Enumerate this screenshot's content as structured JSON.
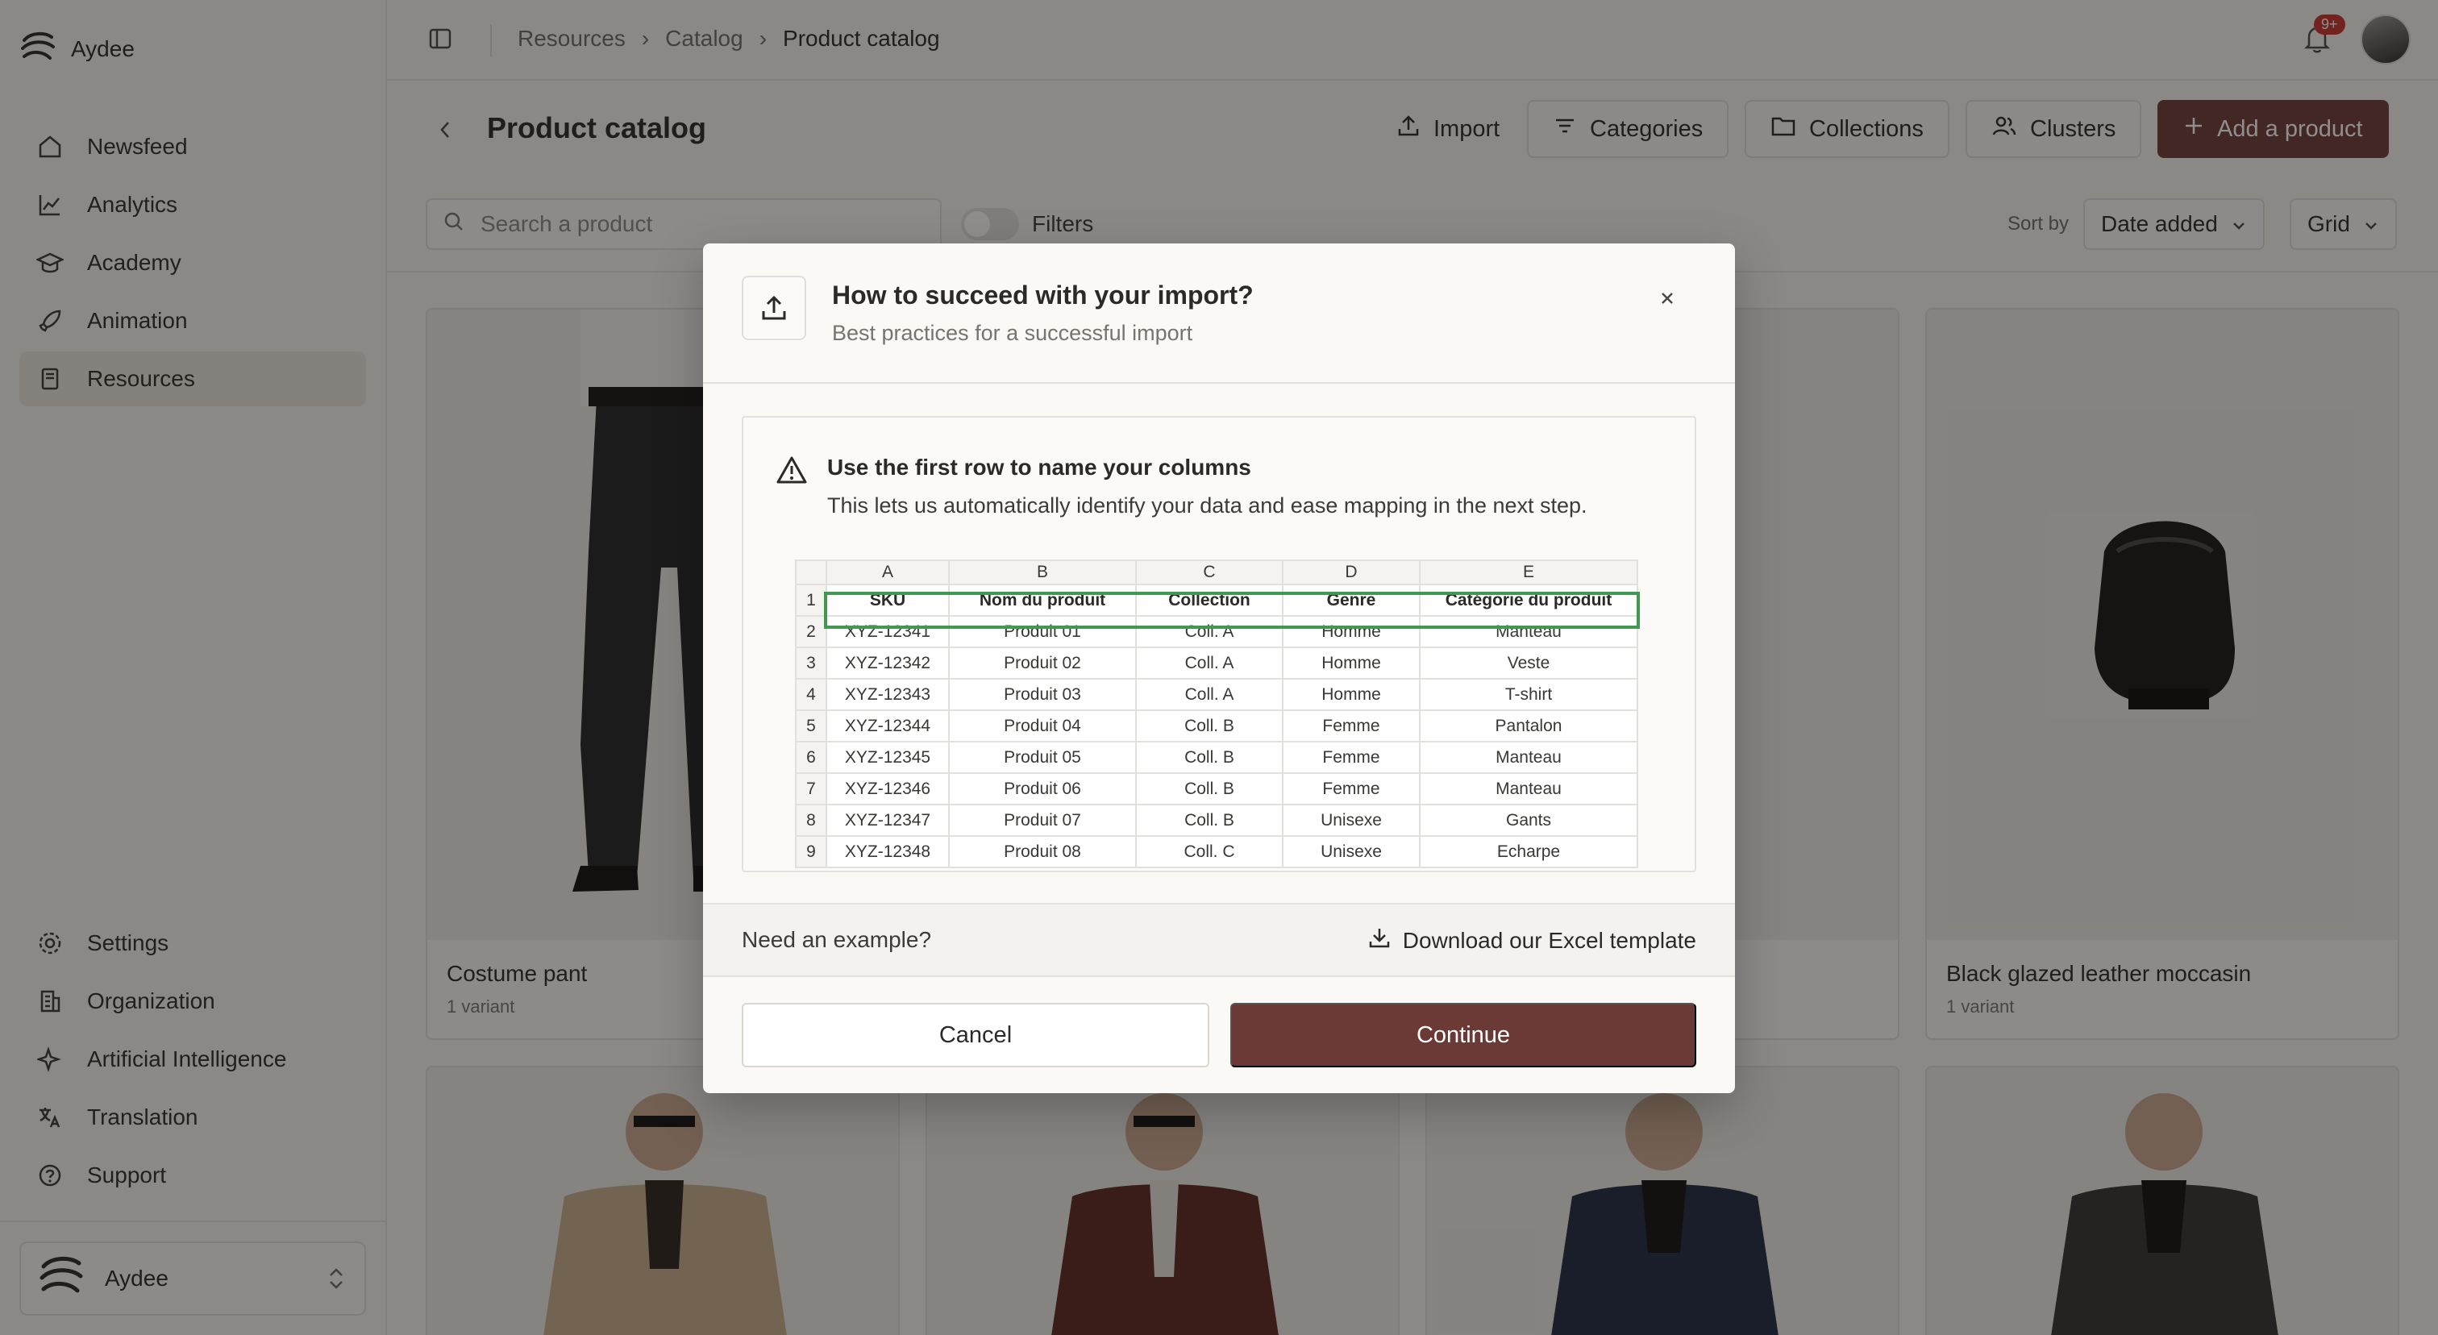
{
  "app": {
    "name": "Aydee",
    "notifications_badge": "9+"
  },
  "sidebar": {
    "items": [
      {
        "label": "Newsfeed",
        "icon": "home-icon"
      },
      {
        "label": "Analytics",
        "icon": "chart-line-icon"
      },
      {
        "label": "Academy",
        "icon": "graduation-cap-icon"
      },
      {
        "label": "Animation",
        "icon": "rocket-icon"
      },
      {
        "label": "Resources",
        "icon": "book-icon",
        "active": true
      }
    ],
    "bottom_items": [
      {
        "label": "Settings",
        "icon": "gear-icon"
      },
      {
        "label": "Organization",
        "icon": "building-icon"
      },
      {
        "label": "Artificial Intelligence",
        "icon": "sparkles-icon"
      },
      {
        "label": "Translation",
        "icon": "translate-icon"
      },
      {
        "label": "Support",
        "icon": "help-circle-icon"
      }
    ],
    "org_switcher": {
      "label": "Aydee"
    }
  },
  "breadcrumb": [
    "Resources",
    "Catalog",
    "Product catalog"
  ],
  "page": {
    "title": "Product catalog",
    "actions": {
      "import": "Import",
      "categories": "Categories",
      "collections": "Collections",
      "clusters": "Clusters",
      "add_product": "Add a product"
    }
  },
  "toolbar": {
    "search_placeholder": "Search a product",
    "filters_label": "Filters",
    "sort_by_label": "Sort by",
    "sort_value": "Date added",
    "view_value": "Grid"
  },
  "products": [
    {
      "name": "Costume pant",
      "variant": "1 variant"
    },
    {
      "name": "Black glazed leather moccasin",
      "variant": "1 variant"
    }
  ],
  "modal": {
    "title": "How to succeed with your import?",
    "subtitle": "Best practices for a successful import",
    "tip_title": "Use the first row to name your columns",
    "tip_text": "This lets us automatically identify your data and ease mapping in the next step.",
    "sheet": {
      "columns": [
        "A",
        "B",
        "C",
        "D",
        "E"
      ],
      "header": [
        "SKU",
        "Nom du produit",
        "Collection",
        "Genre",
        "Catégorie du produit"
      ],
      "rows": [
        [
          "XYZ-12341",
          "Produit 01",
          "Coll. A",
          "Homme",
          "Manteau"
        ],
        [
          "XYZ-12342",
          "Produit 02",
          "Coll. A",
          "Homme",
          "Veste"
        ],
        [
          "XYZ-12343",
          "Produit 03",
          "Coll. A",
          "Homme",
          "T-shirt"
        ],
        [
          "XYZ-12344",
          "Produit 04",
          "Coll. B",
          "Femme",
          "Pantalon"
        ],
        [
          "XYZ-12345",
          "Produit 05",
          "Coll. B",
          "Femme",
          "Manteau"
        ],
        [
          "XYZ-12346",
          "Produit 06",
          "Coll. B",
          "Femme",
          "Manteau"
        ],
        [
          "XYZ-12347",
          "Produit 07",
          "Coll. B",
          "Unisexe",
          "Gants"
        ],
        [
          "XYZ-12348",
          "Produit 08",
          "Coll. C",
          "Unisexe",
          "Echarpe"
        ]
      ]
    },
    "need_example": "Need an example?",
    "download_label": "Download our Excel template",
    "cancel_label": "Cancel",
    "continue_label": "Continue"
  },
  "colors": {
    "primary": "#6b3a36",
    "highlight": "#3f9a4f",
    "badge": "#c8322e"
  }
}
